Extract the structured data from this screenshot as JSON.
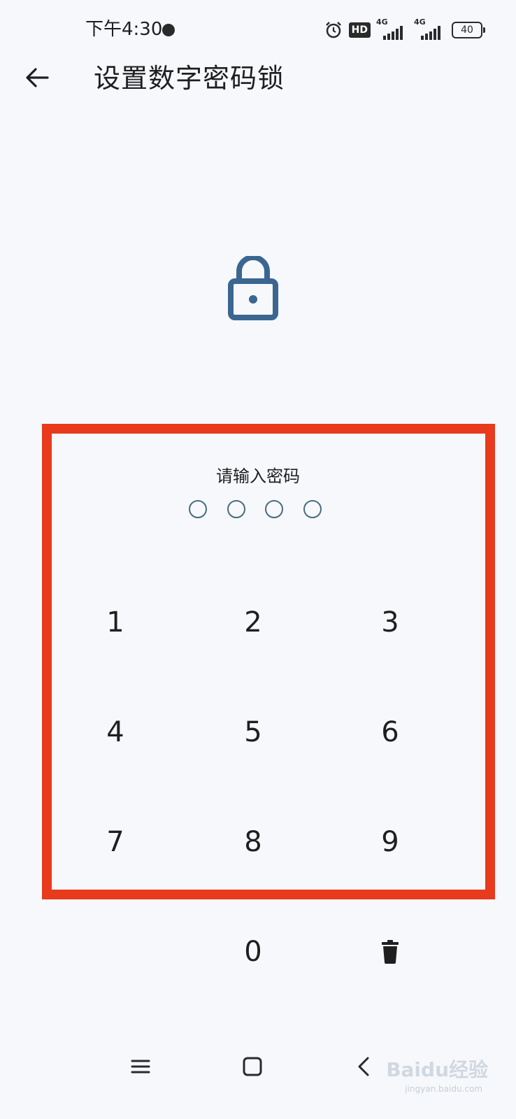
{
  "status_bar": {
    "time": "下午4:30",
    "hd_label": "HD",
    "network_1": "4G",
    "network_2": "4G",
    "battery": "40"
  },
  "header": {
    "title": "设置数字密码锁"
  },
  "pin_entry": {
    "prompt": "请输入密码",
    "digits_entered": 0,
    "digits_total": 4
  },
  "keypad": {
    "keys": [
      "1",
      "2",
      "3",
      "4",
      "5",
      "6",
      "7",
      "8",
      "9",
      "0"
    ]
  },
  "watermark": {
    "text": "Baidu经验",
    "sub": "jingyan.baidu.com"
  },
  "colors": {
    "background": "#f6f8fc",
    "lock_icon": "#3b6690",
    "highlight_border": "#e83a1c",
    "pin_dot": "#4a6b7e"
  },
  "icons": {
    "back": "arrow-left-icon",
    "lock": "lock-icon",
    "delete": "trash-icon",
    "nav_menu": "menu-icon",
    "nav_home": "square-home-icon",
    "nav_back": "chevron-left-icon"
  }
}
